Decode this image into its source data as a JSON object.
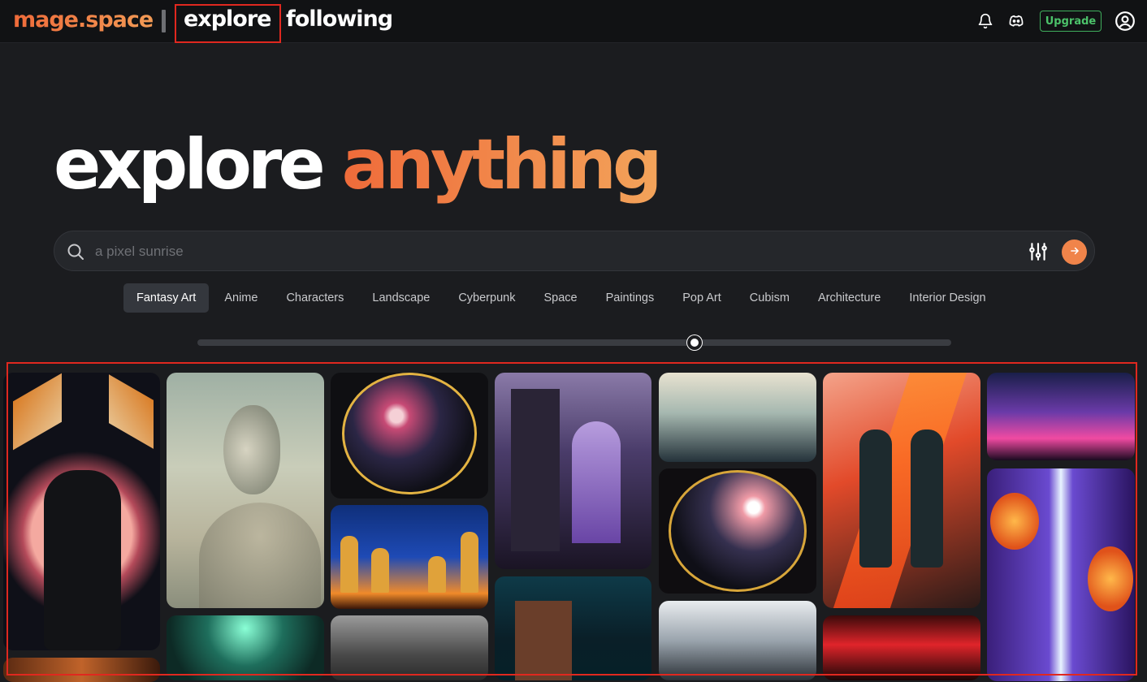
{
  "topbar": {
    "logo": "mage.space",
    "separator": "|",
    "nav": {
      "explore": "explore",
      "following": "following"
    },
    "upgrade_label": "Upgrade",
    "icons": [
      "bell-icon",
      "discord-icon",
      "user-circle-icon"
    ]
  },
  "hero": {
    "word1": "explore",
    "word2": "anything"
  },
  "search": {
    "placeholder": "a pixel sunrise",
    "icons": [
      "search-icon",
      "sliders-icon",
      "arrow-right-icon"
    ]
  },
  "categories": [
    {
      "label": "Fantasy Art",
      "active": true
    },
    {
      "label": "Anime"
    },
    {
      "label": "Characters"
    },
    {
      "label": "Landscape"
    },
    {
      "label": "Cyberpunk"
    },
    {
      "label": "Space"
    },
    {
      "label": "Paintings"
    },
    {
      "label": "Pop Art"
    },
    {
      "label": "Cubism"
    },
    {
      "label": "Architecture"
    },
    {
      "label": "Interior Design"
    }
  ],
  "slider": {
    "value_fraction": 0.66
  },
  "colors": {
    "accent": "#f0844a",
    "highlight_box": "#e0281f",
    "upgrade_green": "#4cc26a"
  }
}
